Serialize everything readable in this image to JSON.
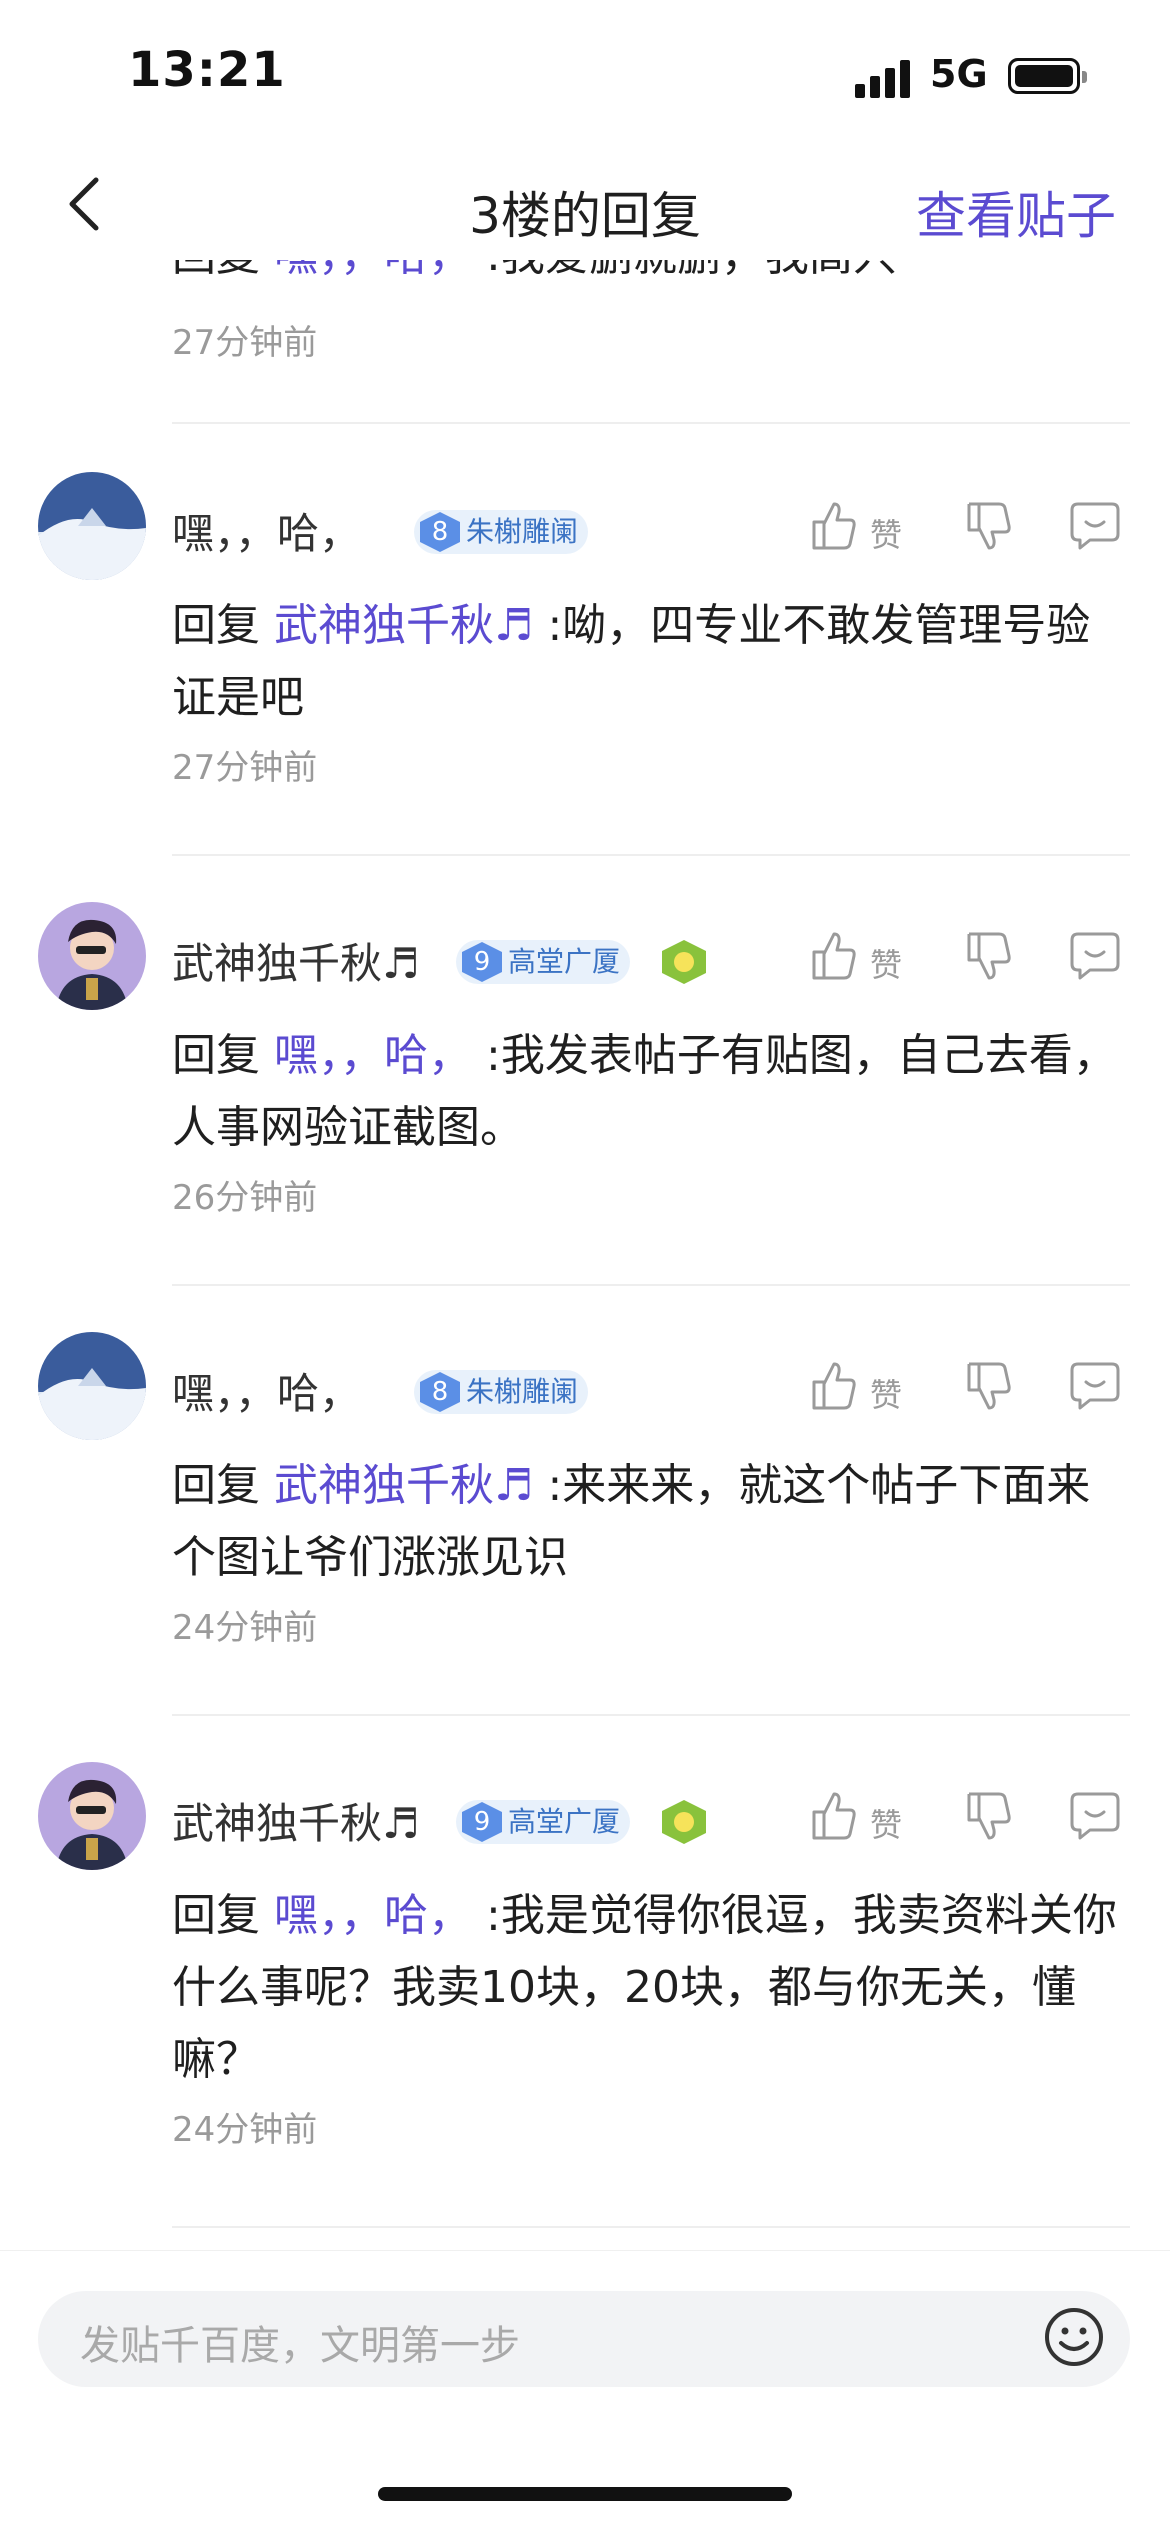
{
  "status_bar": {
    "time": "13:21",
    "network": "5G"
  },
  "nav": {
    "title": "3楼的回复",
    "view_post": "查看贴子"
  },
  "partial_top": {
    "prefix": "回复",
    "mention": "嘿，，哈，",
    "text": ":我爱删就删，我高兴",
    "time": "27分钟前"
  },
  "comments": [
    {
      "username": "嘿，，哈，",
      "badge_level": "8",
      "badge_title": "朱榭雕阑",
      "like_label": "赞",
      "reply_prefix": "回复",
      "reply_to": "武神独千秋♬",
      "text": ":呦，四专业不敢发管理号验证是吧",
      "time": "27分钟前"
    },
    {
      "username": "武神独千秋♬",
      "badge_level": "9",
      "badge_title": "高堂广厦",
      "like_label": "赞",
      "reply_prefix": "回复",
      "reply_to": "嘿，，哈，",
      "text": ":我发表帖子有贴图，自己去看，人事网验证截图。",
      "time": "26分钟前"
    },
    {
      "username": "嘿，，哈，",
      "badge_level": "8",
      "badge_title": "朱榭雕阑",
      "like_label": "赞",
      "reply_prefix": "回复",
      "reply_to": "武神独千秋♬",
      "text": ":来来来，就这个帖子下面来个图让爷们涨涨见识",
      "time": "24分钟前"
    },
    {
      "username": "武神独千秋♬",
      "badge_level": "9",
      "badge_title": "高堂广厦",
      "like_label": "赞",
      "reply_prefix": "回复",
      "reply_to": "嘿，，哈，",
      "text": ":我是觉得你很逗，我卖资料关你什么事呢？我卖10块，20块，都与你无关，懂嘛？",
      "time": "24分钟前"
    }
  ],
  "input": {
    "placeholder": "发贴千百度，文明第一步"
  },
  "colors": {
    "accent": "#5b4bd1",
    "badge_bg": "#e8f1fb",
    "muted": "#9a9a9a"
  }
}
